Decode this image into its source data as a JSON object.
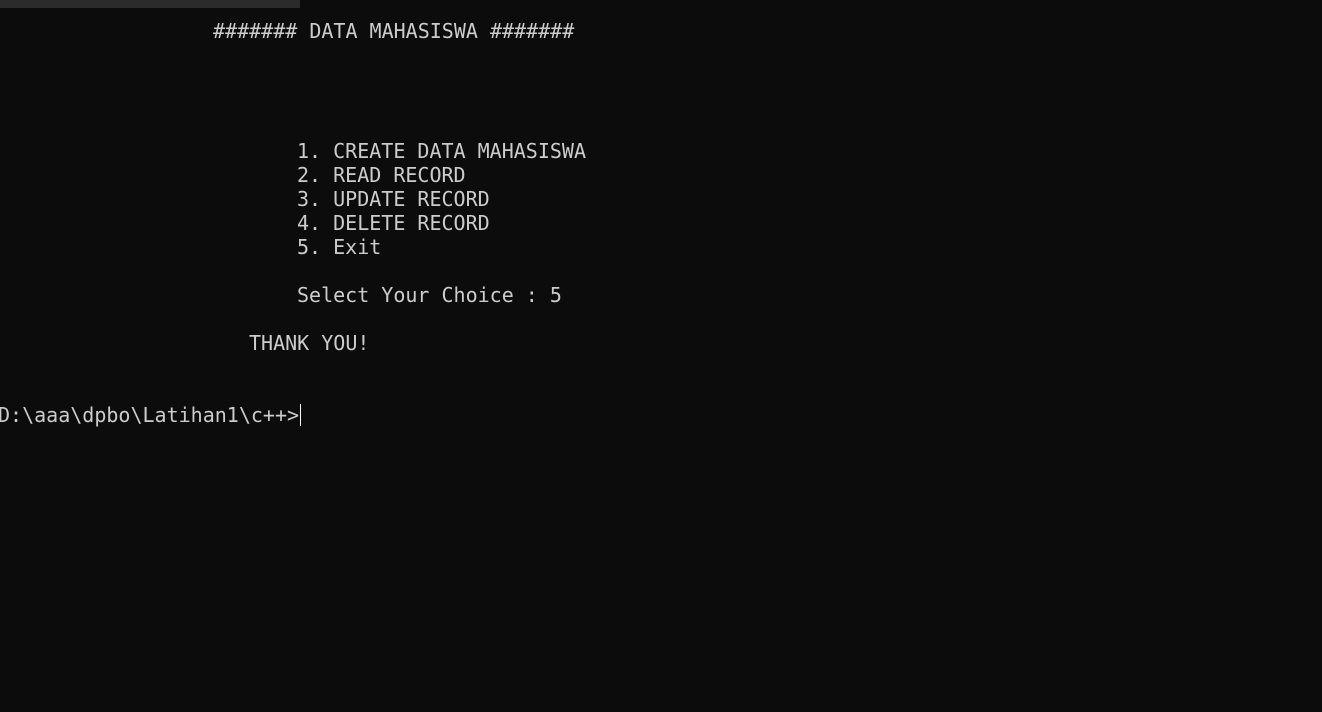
{
  "terminal": {
    "header": "####### DATA MAHASISWA #######",
    "menu_items": [
      "1. CREATE DATA MAHASISWA",
      "2. READ RECORD",
      "3. UPDATE RECORD",
      "4. DELETE RECORD",
      "5. Exit"
    ],
    "choice_prompt": "Select Your Choice : ",
    "choice_value": "5",
    "message": "THANK YOU!",
    "cwd_prompt": "D:\\aaa\\dpbo\\Latihan1\\c++>"
  },
  "colors": {
    "background": "#0c0c0c",
    "foreground": "#cccccc",
    "tab_strip": "#2b2b2b",
    "cursor": "#ffffff"
  }
}
